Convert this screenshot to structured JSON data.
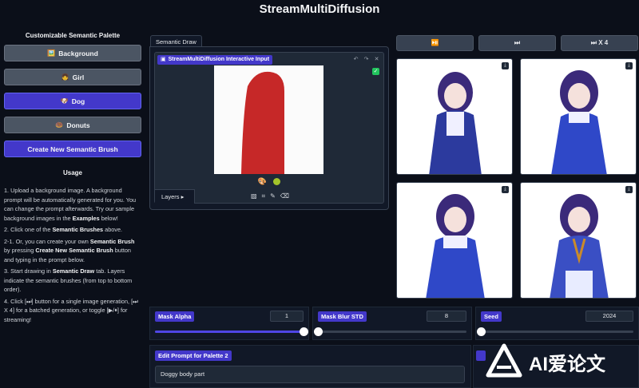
{
  "app": {
    "title": "StreamMultiDiffusion"
  },
  "palette": {
    "heading": "Customizable Semantic Palette",
    "brushes": [
      {
        "icon": "🖼️",
        "label": "Background",
        "active": false
      },
      {
        "icon": "👧",
        "label": "Girl",
        "active": false
      },
      {
        "icon": "🐶",
        "label": "Dog",
        "active": true
      },
      {
        "icon": "🍩",
        "label": "Donuts",
        "active": false
      }
    ],
    "create_label": "Create New Semantic Brush"
  },
  "usage": {
    "heading": "Usage",
    "steps": [
      "1. Upload a background image. A background prompt will be automatically generated for you. You can change the prompt afterwards. Try our sample background images in the <b>Examples</b> below!",
      "2. Click one of the <b>Semantic Brushes</b> above.",
      "2-1. Or, you can create your own <b>Semantic Brush</b> by pressing <b>Create New Semantic Brush</b> button and typing in the prompt below.",
      "3. Start drawing in <b>Semantic Draw</b> tab. Layers indicate the semantic brushes (from top to bottom order).",
      "4. Click [⏭] button for a single image generation, [⏭ X 4] for a batched generation, or toggle [▶/⏸] for streaming!"
    ]
  },
  "semantic_draw": {
    "tab_label": "Semantic Draw",
    "editor_label": "StreamMultiDiffusion Interactive Input",
    "layers_label": "Layers",
    "stroke_color": "#c62828",
    "brush_dot_color": "#a3c42a"
  },
  "controls": {
    "stream_toggle": "⏯️",
    "generate_single": "⏭",
    "generate_batch": "⏭ X 4"
  },
  "sliders": [
    {
      "label": "Mask Alpha",
      "value": "1",
      "fraction": 1.0
    },
    {
      "label": "Mask Blur STD",
      "value": "8",
      "fraction": 0.0
    },
    {
      "label": "Seed",
      "value": "2024",
      "fraction": 0.0
    }
  ],
  "prompt": {
    "label": "Edit Prompt for Palette 2",
    "value": "Doggy body part"
  },
  "watermark": {
    "text": "AI爱论文"
  }
}
